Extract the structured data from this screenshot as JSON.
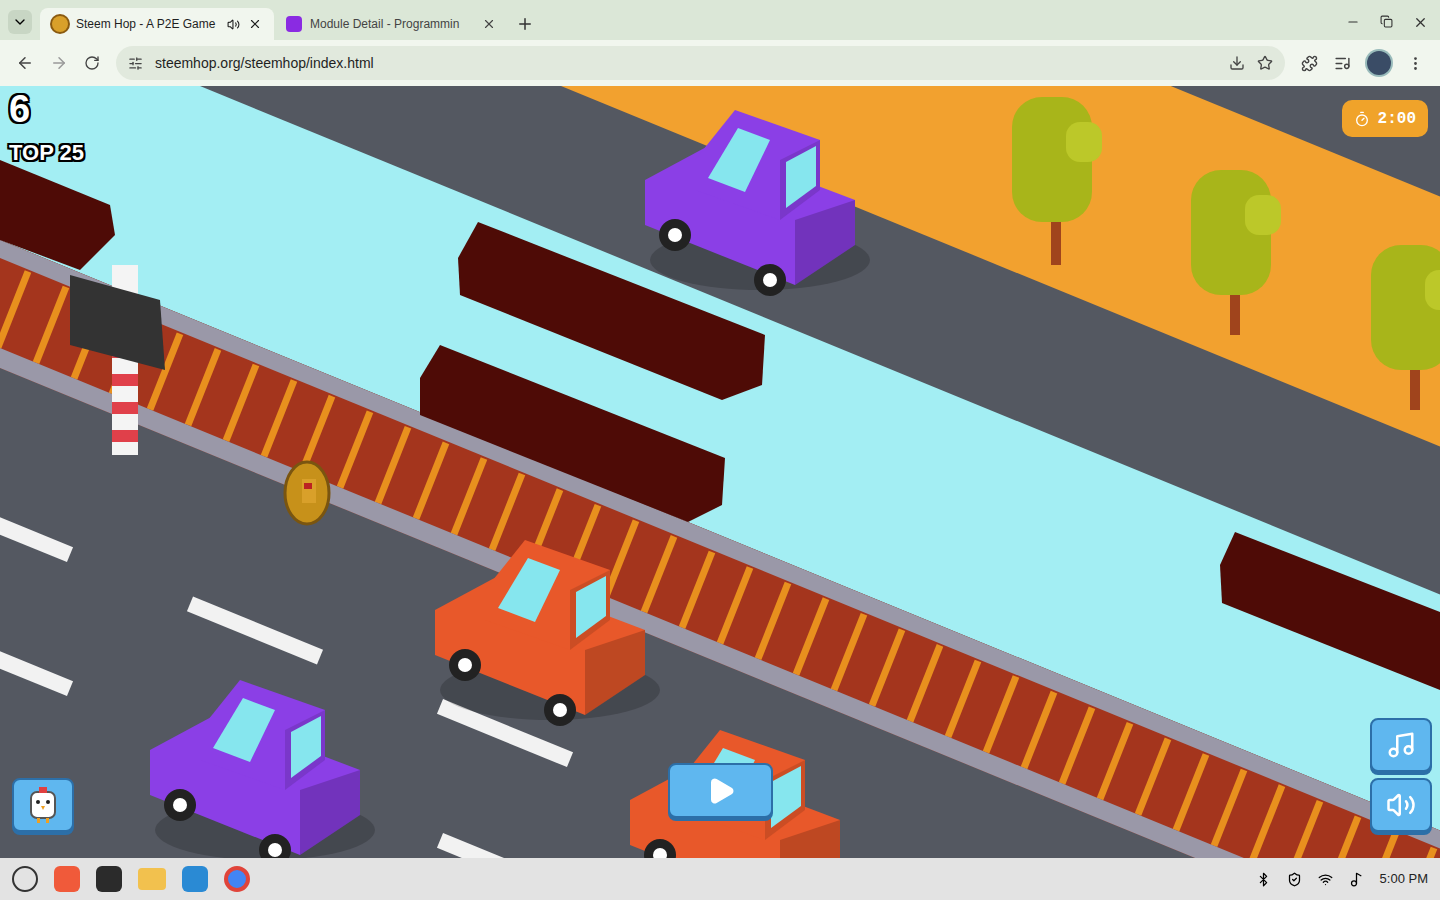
{
  "browser": {
    "tabs": [
      {
        "label": "Steem Hop - A P2E Game",
        "selected": true,
        "audio_playing": true
      },
      {
        "label": "Module Detail - Programmin",
        "selected": false,
        "audio_playing": false
      }
    ],
    "url": "steemhop.org/steemhop/index.html",
    "bookmarked": false
  },
  "game": {
    "score": "6",
    "rank": "TOP 25",
    "timer": "2:00",
    "cars": [
      {
        "color": "#8b3fe6"
      },
      {
        "color": "#e8582a"
      },
      {
        "color": "#8b3fe6"
      },
      {
        "color": "#e8582a"
      }
    ],
    "music_on": true,
    "sound_on": true
  },
  "taskbar": {
    "clock": "5:00 PM"
  }
}
